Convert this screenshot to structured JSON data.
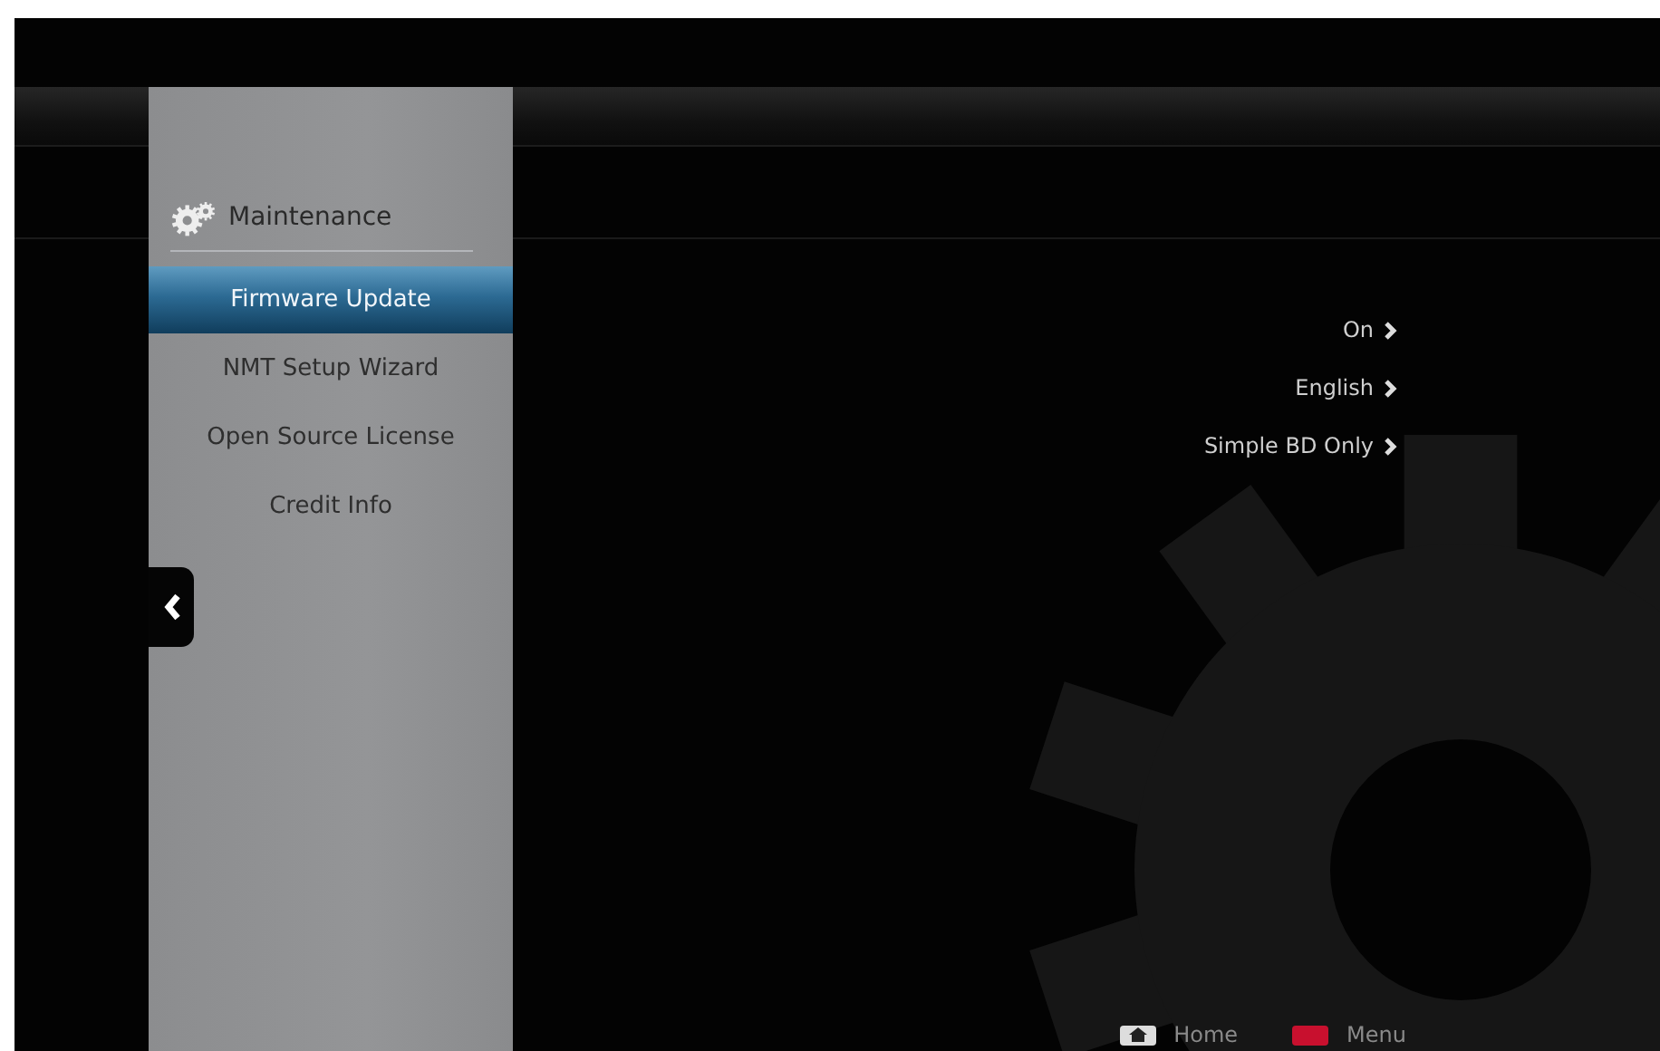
{
  "sidebar": {
    "title": "Maintenance",
    "items": [
      {
        "label": "Firmware Update",
        "selected": true
      },
      {
        "label": "NMT Setup Wizard",
        "selected": false
      },
      {
        "label": "Open Source License",
        "selected": false
      },
      {
        "label": "Credit Info",
        "selected": false
      }
    ]
  },
  "settings": [
    {
      "value": "On"
    },
    {
      "value": "English"
    },
    {
      "value": "Simple BD Only"
    }
  ],
  "footer": [
    {
      "kind": "home",
      "label": "Home"
    },
    {
      "kind": "red",
      "label": "Menu",
      "color": "#c8102e"
    }
  ]
}
